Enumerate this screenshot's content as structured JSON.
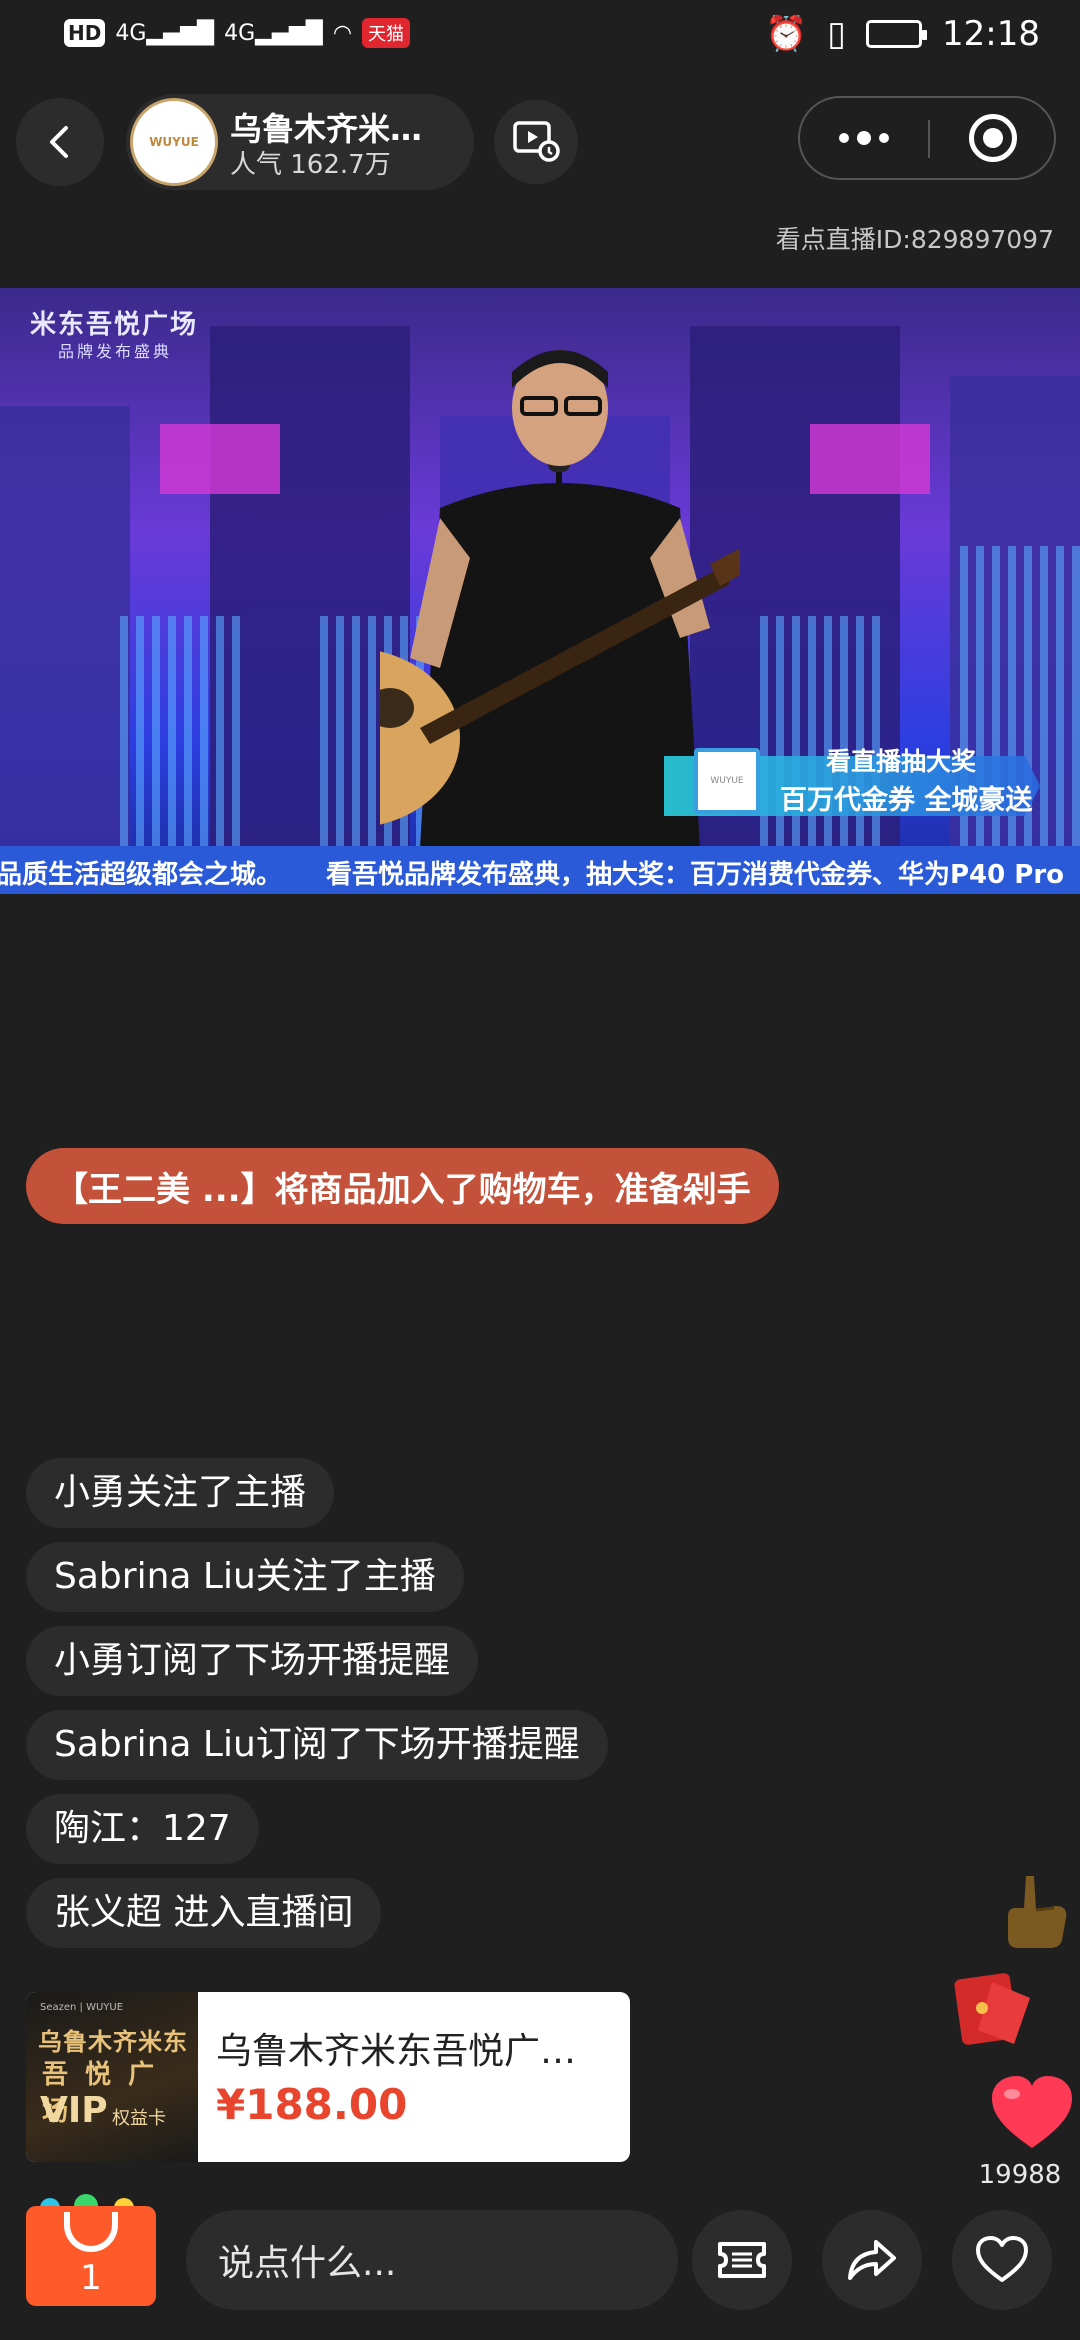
{
  "status_bar": {
    "left_hd": "HD",
    "left_hd_sub": "2",
    "signal1": "4G",
    "signal2": "4G",
    "tmall_badge": "天猫",
    "time": "12:18"
  },
  "header": {
    "anchor_name": "乌鲁木齐米…",
    "popularity": "人气 162.7万",
    "avatar_logo": "WUYUE"
  },
  "live_id": "看点直播ID:829897097",
  "video": {
    "venue_title": "米东吾悦广场",
    "venue_subtitle": "品牌发布盛典",
    "prize_line1": "看直播抽大奖",
    "prize_line2": "百万代金券 全城豪送",
    "prize_logo": "WUYUE",
    "ticker_a": "品质生活超级都会之城。",
    "ticker_b": "看吾悦品牌发布盛典，抽大奖：百万消费代金券、华为P40 Pro"
  },
  "cart_notice": "【王二美 ...】将商品加入了购物车，准备剁手",
  "comments": [
    {
      "text": "小勇关注了主播"
    },
    {
      "text": "Sabrina Liu关注了主播"
    },
    {
      "text": "小勇订阅了下场开播提醒"
    },
    {
      "text": "Sabrina Liu订阅了下场开播提醒"
    },
    {
      "text": "陶江：127"
    },
    {
      "text": "张义超 进入直播间"
    }
  ],
  "product": {
    "title": "乌鲁木齐米东吾悦广…",
    "price": "¥188.00",
    "img_line1": "乌鲁木齐米东",
    "img_line2": "吾 悦 广 场",
    "img_line3": "VIP",
    "img_line4": "权益卡",
    "img_top": "Seazen | WUYUE"
  },
  "likes": "19988",
  "bottom": {
    "cart_count": "1",
    "input_placeholder": "说点什么..."
  },
  "colors": {
    "background": "#1f1f1f",
    "pill": "#2c2c2c",
    "notice": "#c4523b",
    "price": "#e8452e",
    "cart": "#ff5a2a"
  }
}
